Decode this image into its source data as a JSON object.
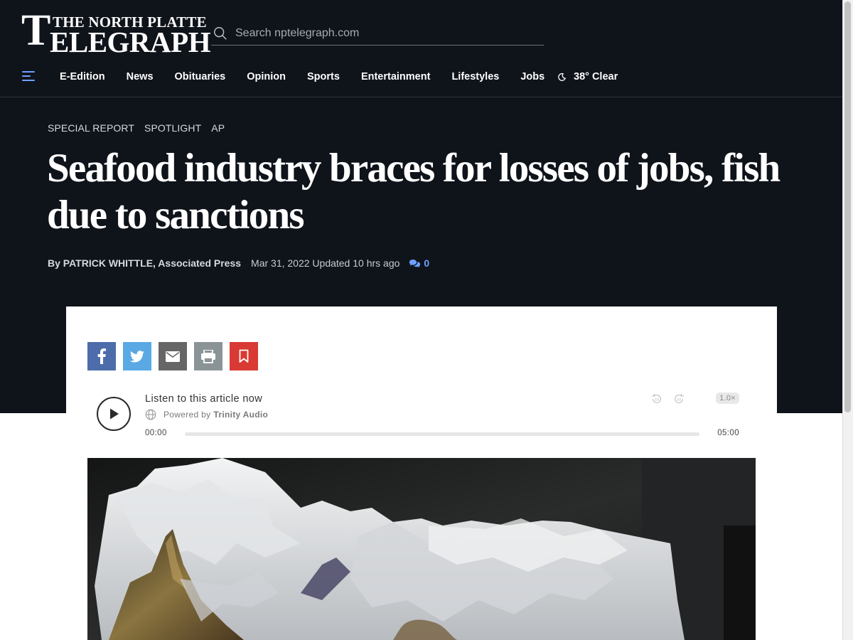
{
  "masthead": {
    "logo_top": "THE NORTH PLATTE",
    "logo_big_letter": "T",
    "logo_rest": "ELEGRAPH",
    "search_placeholder": "Search nptelegraph.com"
  },
  "nav": {
    "items": [
      "E-Edition",
      "News",
      "Obituaries",
      "Opinion",
      "Sports",
      "Entertainment",
      "Lifestyles",
      "Jobs"
    ],
    "weather": "38° Clear"
  },
  "article": {
    "kickers": [
      "SPECIAL REPORT",
      "SPOTLIGHT",
      "AP"
    ],
    "headline": "Seafood industry braces for losses of jobs, fish due to sanctions",
    "byline_prefix": "By",
    "byline_author": "PATRICK WHITTLE, Associated Press",
    "dateline": "Mar 31, 2022 Updated 10 hrs ago",
    "comment_count": "0"
  },
  "share": {
    "buttons": [
      {
        "icon": "facebook-icon",
        "color": "#4c6daa"
      },
      {
        "icon": "twitter-icon",
        "color": "#5aa9e4"
      },
      {
        "icon": "email-icon",
        "color": "#666666"
      },
      {
        "icon": "print-icon",
        "color": "#8a9497"
      },
      {
        "icon": "bookmark-icon",
        "color": "#d93a33"
      }
    ]
  },
  "audio": {
    "title": "Listen to this article now",
    "powered_prefix": "Powered by",
    "powered_brand": "Trinity Audio",
    "time_current": "00:00",
    "time_total": "05:00",
    "progress": 0,
    "speed": "1.0×",
    "rewind_label": "10",
    "forward_label": "10"
  },
  "colors": {
    "header_bg": "#0f131a",
    "accent": "#6ea0ff"
  }
}
